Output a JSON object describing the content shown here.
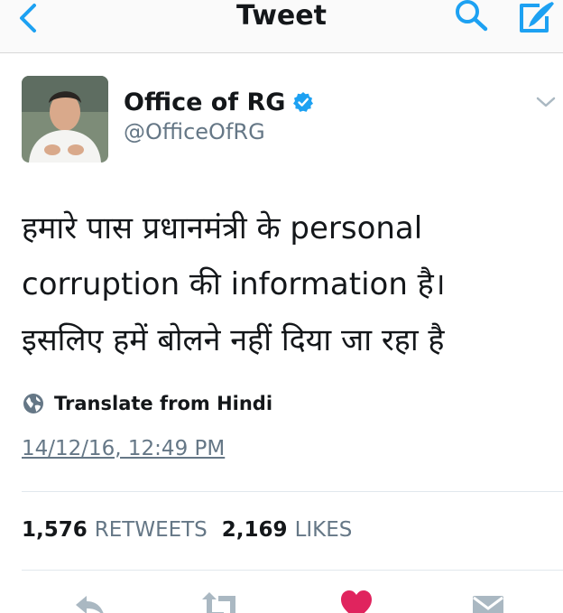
{
  "header": {
    "title": "Tweet",
    "back_icon": "chevron-left-icon",
    "search_icon": "search-icon",
    "compose_icon": "compose-icon",
    "accent_color": "#1da1f2"
  },
  "author": {
    "display_name": "Office of RG",
    "handle": "@OfficeOfRG",
    "verified": true
  },
  "tweet": {
    "lines": [
      "हमारे पास प्रधानमंत्री के personal",
      "corruption की information है।",
      "इसलिए हमें बोलने नहीं दिया जा रहा है"
    ],
    "translate_label": "Translate from Hindi",
    "timestamp": "14/12/16, 12:49 PM"
  },
  "stats": {
    "retweets_count": "1,576",
    "retweets_label": "RETWEETS",
    "likes_count": "2,169",
    "likes_label": "LIKES"
  },
  "actions": {
    "icons": [
      "reply-icon",
      "retweet-icon",
      "like-icon",
      "direct-message-icon"
    ],
    "like_color": "#e0245e"
  }
}
